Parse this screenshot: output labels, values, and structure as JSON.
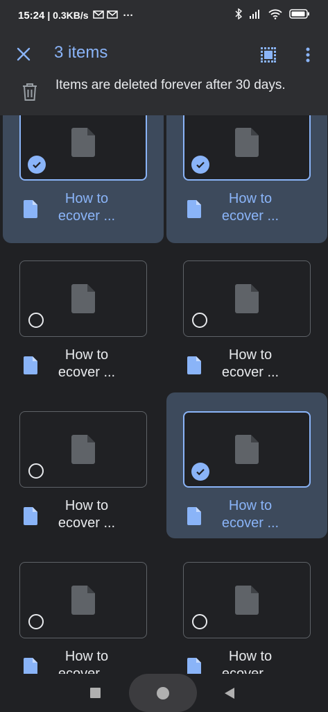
{
  "status_bar": {
    "time": "15:24",
    "network_speed": "| 0.3KB/s",
    "notification_icons": [
      "gmail-icon",
      "gmail-icon"
    ],
    "overflow": "···",
    "right_icons": [
      "bluetooth-icon",
      "signal-icon",
      "wifi-icon",
      "battery-icon"
    ]
  },
  "app_bar": {
    "title": "3 items",
    "notice": "Items are deleted forever after 30 days."
  },
  "files": [
    {
      "name": "How to ecover ...",
      "selected": true
    },
    {
      "name": "How to ecover ...",
      "selected": true
    },
    {
      "name": "How to ecover ...",
      "selected": false
    },
    {
      "name": "How to ecover ...",
      "selected": false
    },
    {
      "name": "How to ecover ...",
      "selected": false
    },
    {
      "name": "How to ecover ...",
      "selected": true
    },
    {
      "name": "How to ecover ...",
      "selected": false
    },
    {
      "name": "How to ecover ...",
      "selected": false
    }
  ],
  "colors": {
    "accent": "#8ab4f8",
    "selected_card": "#3d4a5c",
    "background": "#202124",
    "bar": "#2d2e31"
  }
}
